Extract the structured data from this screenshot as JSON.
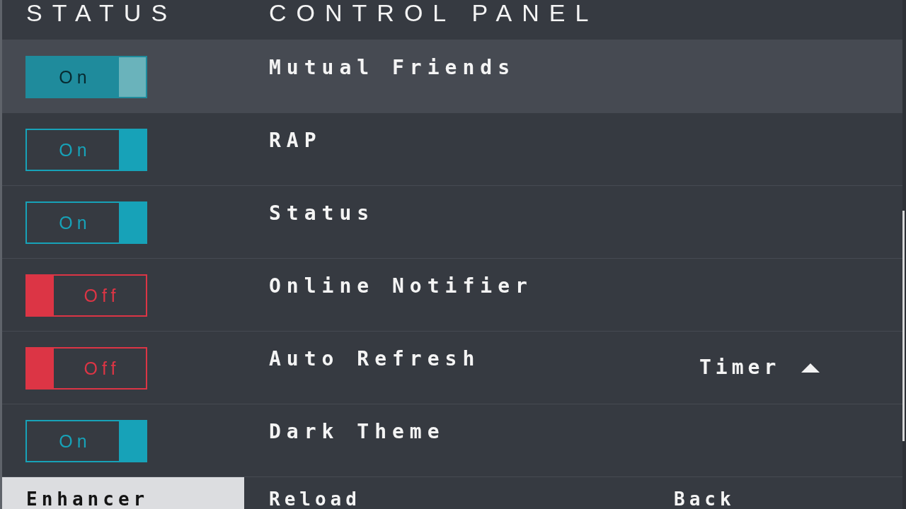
{
  "header": {
    "columns": [
      "STATUS",
      "CONTROL PANEL"
    ]
  },
  "settings": [
    {
      "label": "Mutual Friends",
      "state_label": "On",
      "on": true,
      "selected": true
    },
    {
      "label": "RAP",
      "state_label": "On",
      "on": true,
      "selected": false
    },
    {
      "label": "Status",
      "state_label": "On",
      "on": true,
      "selected": false
    },
    {
      "label": "Online Notifier",
      "state_label": "Off",
      "on": false,
      "selected": false
    },
    {
      "label": "Auto Refresh",
      "state_label": "Off",
      "on": false,
      "selected": false,
      "timer": {
        "label": "Timer",
        "expanded": true
      }
    },
    {
      "label": "Dark Theme",
      "state_label": "On",
      "on": true,
      "selected": false
    }
  ],
  "footer": [
    {
      "label": "Enhancer",
      "selected": true
    },
    {
      "label": "Reload",
      "selected": false
    },
    {
      "label": "Back",
      "selected": false
    }
  ]
}
